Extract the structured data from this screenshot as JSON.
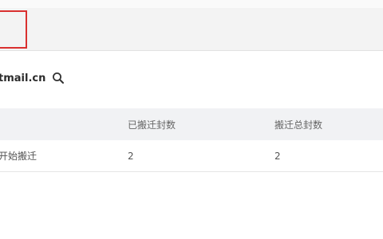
{
  "account": {
    "email_fragment": "tmail.cn"
  },
  "icons": {
    "search": "search-icon"
  },
  "table": {
    "headers": [
      " ",
      "已搬迁封数",
      "搬迁总封数"
    ],
    "rows": [
      [
        "开始搬迁",
        "2",
        "2"
      ]
    ]
  }
}
